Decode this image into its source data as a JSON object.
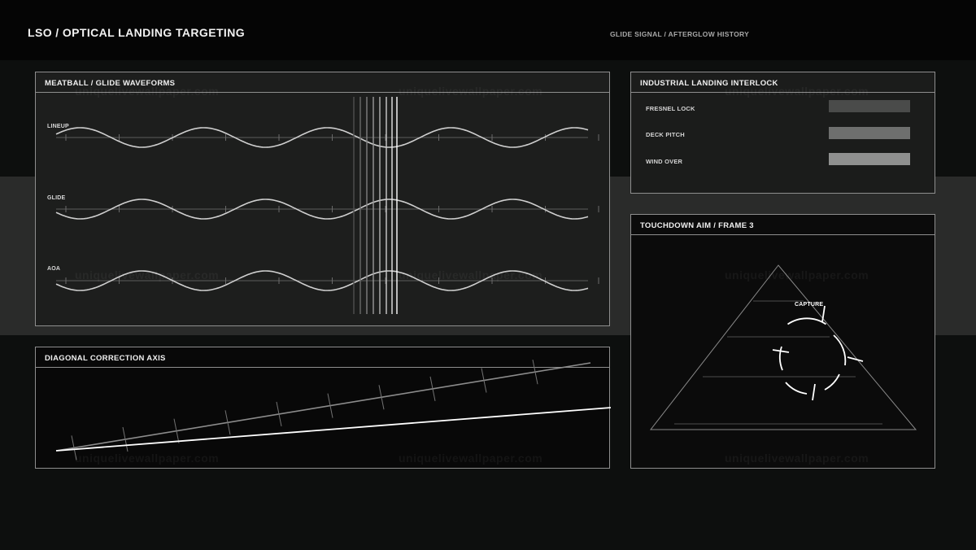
{
  "header": {
    "title": "LSO / OPTICAL LANDING TARGETING",
    "subtitle": "GLIDE SIGNAL / AFTERGLOW HISTORY"
  },
  "waveforms_panel": {
    "title": "MEATBALL / GLIDE WAVEFORMS",
    "rows": [
      {
        "label": "LINEUP"
      },
      {
        "label": "GLIDE"
      },
      {
        "label": "AOA"
      }
    ]
  },
  "interlock_panel": {
    "title": "INDUSTRIAL LANDING INTERLOCK",
    "items": [
      {
        "label": "FRESNEL LOCK",
        "color": "#4a4b4a"
      },
      {
        "label": "DECK PITCH",
        "color": "#6e6f6e"
      },
      {
        "label": "WIND OVER",
        "color": "#8f908f"
      }
    ]
  },
  "correction_panel": {
    "title": "DIAGONAL CORRECTION AXIS"
  },
  "aim_panel": {
    "title": "TOUCHDOWN AIM / FRAME 3",
    "capture_label": "CAPTURE"
  },
  "watermark": "uniquelivewallpaper.com",
  "colors": {
    "background": "#0d0f0e",
    "topbar": "#050505",
    "band": "#2a2b2a",
    "panel_border": "#8e8e8e",
    "wave": "#cfcfcf",
    "accent_line": "#ffffff"
  },
  "icons": {
    "reticle": "capture-reticle-icon",
    "pyramid": "glide-pyramid-icon"
  }
}
